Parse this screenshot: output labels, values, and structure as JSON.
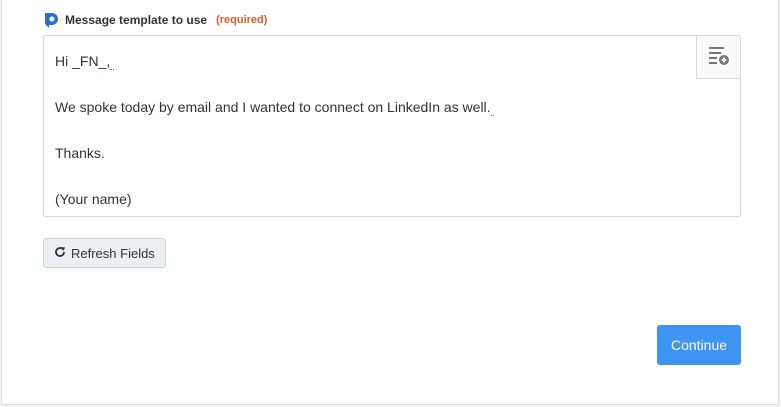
{
  "field": {
    "label": "Message template to use",
    "required": "(required)",
    "app_icon": "app-logo-icon"
  },
  "message": {
    "lines": [
      "Hi _FN_,",
      "We spoke today by email and I wanted to connect on LinkedIn as well.",
      "Thanks.",
      "(Your name)"
    ],
    "insert_field_icon": "insert-field-icon"
  },
  "buttons": {
    "refresh_label": "Refresh Fields",
    "refresh_icon": "refresh-icon",
    "continue_label": "Continue"
  },
  "colors": {
    "accent": "#3e95f1",
    "required": "#e3592a",
    "app_icon": "#2a6fd6"
  }
}
